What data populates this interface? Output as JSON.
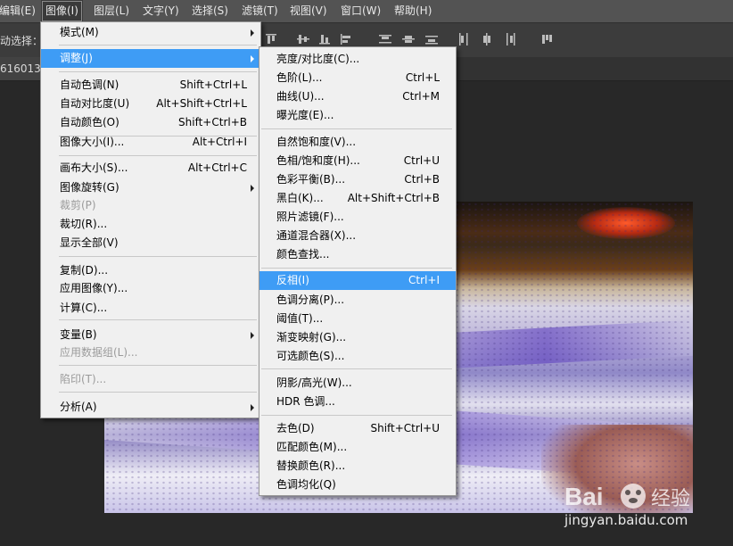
{
  "menubar": {
    "items": [
      "编辑(E)",
      "图像(I)",
      "图层(L)",
      "文字(Y)",
      "选择(S)",
      "滤镜(T)",
      "视图(V)",
      "窗口(W)",
      "帮助(H)"
    ]
  },
  "options_bar": {
    "auto_select_label": "动选择："
  },
  "document_tab": {
    "title": "616013"
  },
  "image_menu": {
    "items": [
      {
        "label": "模式(M)",
        "shortcut": "",
        "submenu": true,
        "disabled": false
      },
      {
        "label": "调整(J)",
        "shortcut": "",
        "submenu": true,
        "disabled": false,
        "highlighted": true
      },
      {
        "label": "自动色调(N)",
        "shortcut": "Shift+Ctrl+L"
      },
      {
        "label": "自动对比度(U)",
        "shortcut": "Alt+Shift+Ctrl+L"
      },
      {
        "label": "自动颜色(O)",
        "shortcut": "Shift+Ctrl+B"
      },
      {
        "label": "图像大小(I)...",
        "shortcut": "Alt+Ctrl+I"
      },
      {
        "label": "画布大小(S)...",
        "shortcut": "Alt+Ctrl+C"
      },
      {
        "label": "图像旋转(G)",
        "shortcut": "",
        "submenu": true
      },
      {
        "label": "裁剪(P)",
        "shortcut": "",
        "disabled": true
      },
      {
        "label": "裁切(R)...",
        "shortcut": ""
      },
      {
        "label": "显示全部(V)",
        "shortcut": ""
      },
      {
        "label": "复制(D)...",
        "shortcut": ""
      },
      {
        "label": "应用图像(Y)...",
        "shortcut": ""
      },
      {
        "label": "计算(C)...",
        "shortcut": ""
      },
      {
        "label": "变量(B)",
        "shortcut": "",
        "submenu": true
      },
      {
        "label": "应用数据组(L)...",
        "shortcut": "",
        "disabled": true
      },
      {
        "label": "陷印(T)...",
        "shortcut": "",
        "disabled": true
      },
      {
        "label": "分析(A)",
        "shortcut": "",
        "submenu": true
      }
    ]
  },
  "adjust_menu": {
    "items": [
      {
        "label": "亮度/对比度(C)...",
        "shortcut": ""
      },
      {
        "label": "色阶(L)...",
        "shortcut": "Ctrl+L"
      },
      {
        "label": "曲线(U)...",
        "shortcut": "Ctrl+M"
      },
      {
        "label": "曝光度(E)...",
        "shortcut": ""
      },
      {
        "label": "自然饱和度(V)...",
        "shortcut": ""
      },
      {
        "label": "色相/饱和度(H)...",
        "shortcut": "Ctrl+U"
      },
      {
        "label": "色彩平衡(B)...",
        "shortcut": "Ctrl+B"
      },
      {
        "label": "黑白(K)...",
        "shortcut": "Alt+Shift+Ctrl+B"
      },
      {
        "label": "照片滤镜(F)...",
        "shortcut": ""
      },
      {
        "label": "通道混合器(X)...",
        "shortcut": ""
      },
      {
        "label": "颜色查找...",
        "shortcut": ""
      },
      {
        "label": "反相(I)",
        "shortcut": "Ctrl+I",
        "highlighted": true
      },
      {
        "label": "色调分离(P)...",
        "shortcut": ""
      },
      {
        "label": "阈值(T)...",
        "shortcut": ""
      },
      {
        "label": "渐变映射(G)...",
        "shortcut": ""
      },
      {
        "label": "可选颜色(S)...",
        "shortcut": ""
      },
      {
        "label": "阴影/高光(W)...",
        "shortcut": ""
      },
      {
        "label": "HDR 色调...",
        "shortcut": ""
      },
      {
        "label": "去色(D)",
        "shortcut": "Shift+Ctrl+U"
      },
      {
        "label": "匹配颜色(M)...",
        "shortcut": ""
      },
      {
        "label": "替换颜色(R)...",
        "shortcut": ""
      },
      {
        "label": "色调均化(Q)",
        "shortcut": ""
      }
    ]
  },
  "watermark": {
    "brand": "Bai",
    "brand_cn": "经验",
    "url": "jingyan.baidu.com"
  },
  "colors": {
    "menubar_bg": "#535353",
    "menu_bg": "#f0f0f0",
    "highlight": "#3e9cf5",
    "workspace_bg": "#282828"
  }
}
